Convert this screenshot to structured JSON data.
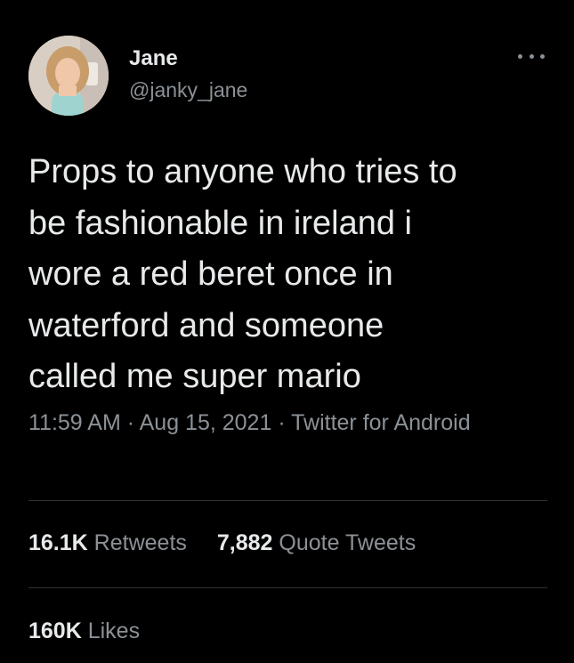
{
  "author": {
    "display_name": "Jane",
    "handle": "@janky_jane",
    "avatar_icon": "profile-photo"
  },
  "menu": {
    "icon": "more-options-icon"
  },
  "tweet": {
    "text": "Props to anyone who tries to\nbe fashionable in ireland i\nwore a red beret once in\nwaterford and someone\ncalled me super mario",
    "time": "11:59 AM",
    "date": "Aug 15, 2021",
    "source": "Twitter for Android",
    "separator": " · "
  },
  "stats": {
    "retweets": {
      "value": "16.1K",
      "label": "Retweets"
    },
    "quote_tweets": {
      "value": "7,882",
      "label": "Quote Tweets"
    },
    "likes": {
      "value": "160K",
      "label": "Likes"
    }
  },
  "colors": {
    "background": "#000000",
    "primary_text": "#e7e9ea",
    "secondary_text": "#8b9196",
    "divider": "#2f3336"
  }
}
